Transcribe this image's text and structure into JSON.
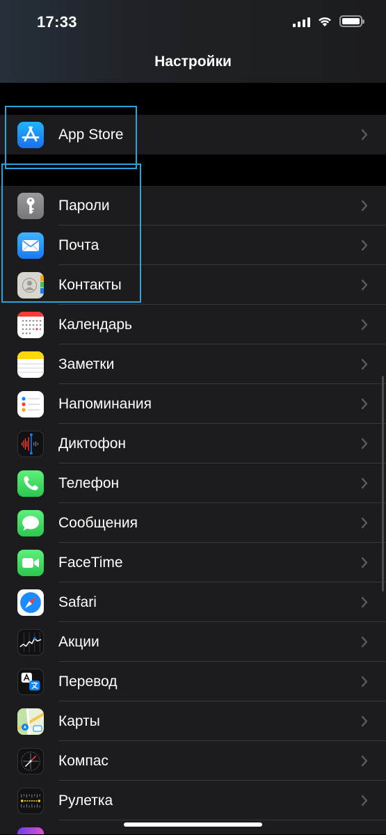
{
  "status_bar": {
    "time": "17:33",
    "battery_level": 1.0,
    "signal_bars": 4
  },
  "nav": {
    "title": "Настройки"
  },
  "groups": [
    {
      "items": [
        {
          "label": "App Store",
          "icon": "app-store-icon"
        }
      ]
    },
    {
      "items": [
        {
          "label": "Пароли",
          "icon": "key-icon"
        },
        {
          "label": "Почта",
          "icon": "mail-icon"
        },
        {
          "label": "Контакты",
          "icon": "contacts-icon"
        },
        {
          "label": "Календарь",
          "icon": "calendar-icon"
        },
        {
          "label": "Заметки",
          "icon": "notes-icon"
        },
        {
          "label": "Напоминания",
          "icon": "reminders-icon"
        },
        {
          "label": "Диктофон",
          "icon": "voice-memos-icon"
        },
        {
          "label": "Телефон",
          "icon": "phone-icon"
        },
        {
          "label": "Сообщения",
          "icon": "messages-icon"
        },
        {
          "label": "FaceTime",
          "icon": "facetime-icon"
        },
        {
          "label": "Safari",
          "icon": "safari-icon"
        },
        {
          "label": "Акции",
          "icon": "stocks-icon"
        },
        {
          "label": "Перевод",
          "icon": "translate-icon"
        },
        {
          "label": "Карты",
          "icon": "maps-icon"
        },
        {
          "label": "Компас",
          "icon": "compass-icon"
        },
        {
          "label": "Рулетка",
          "icon": "measure-icon"
        }
      ]
    }
  ],
  "colors": {
    "background": "#000000",
    "row_background": "#1c1c1e",
    "separator": "#38383a",
    "chevron": "#5a5a5e",
    "highlight_border": "#2ba3db"
  }
}
